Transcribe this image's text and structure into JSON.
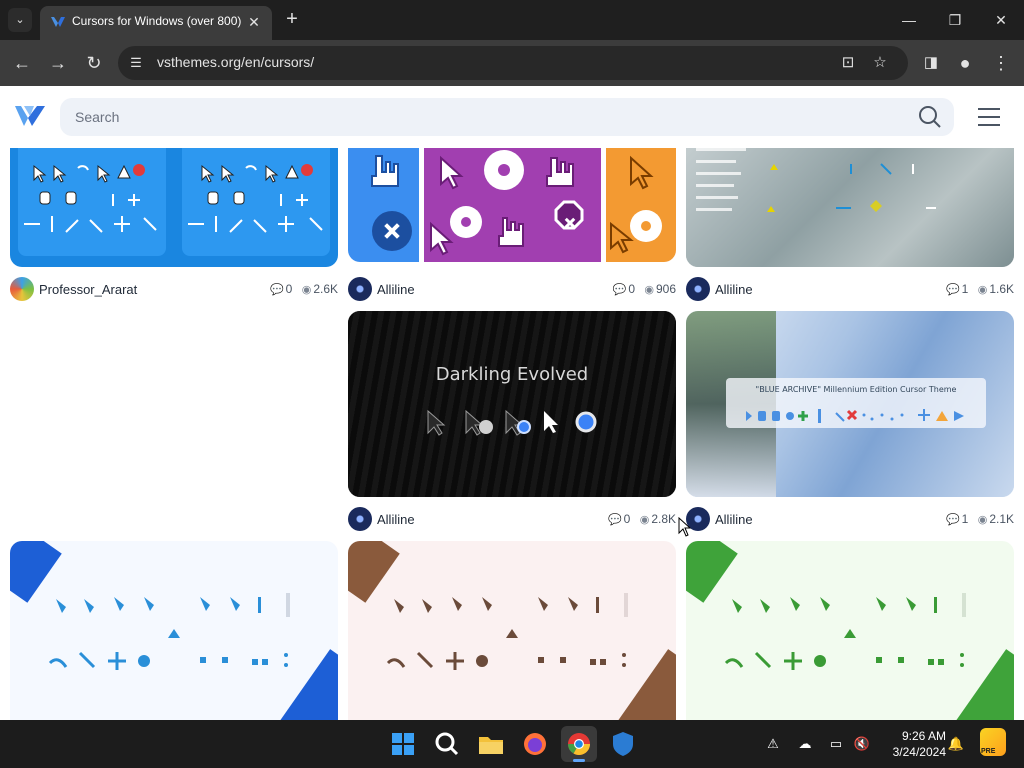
{
  "browser": {
    "tab_title": "Cursors for Windows (over 800)",
    "url": "vsthemes.org/en/cursors/",
    "tab_close": "✕",
    "new_tab": "+",
    "tab_search": "⌄",
    "window_controls": {
      "minimize": "—",
      "maximize": "❐",
      "close": "✕"
    },
    "nav": {
      "back": "←",
      "forward": "→",
      "reload": "↻"
    }
  },
  "site": {
    "search_placeholder": "Search"
  },
  "cards": [
    {
      "author": "Professor_Ararat",
      "comments": "0",
      "views": "2.6K"
    },
    {
      "author": "Alliline",
      "comments": "0",
      "views": "906"
    },
    {
      "author": "Alliline",
      "comments": "1",
      "views": "1.6K"
    },
    {
      "author": "Alliline",
      "comments": "0",
      "views": "2.8K",
      "image_title": "Darkling Evolved"
    },
    {
      "author": "Alliline",
      "comments": "1",
      "views": "2.1K",
      "image_title": "\"BLUE ARCHIVE\" Millennium Edition Cursor Theme"
    }
  ],
  "taskbar": {
    "time": "9:26 AM",
    "date": "3/24/2024",
    "copilot_badge": "PRE"
  },
  "colors": {
    "tabstrip": "#1f1f1f",
    "toolbar": "#3c3c3c",
    "accent": "#2f6fdd",
    "taskbar": "#1c1c1c"
  }
}
